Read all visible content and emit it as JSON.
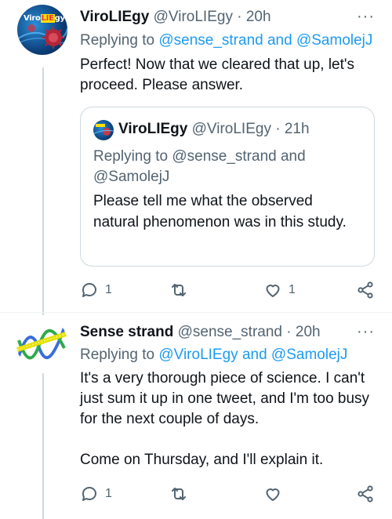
{
  "tweet1": {
    "name": "ViroLIEgy",
    "handle": "@ViroLIEgy",
    "separator": "·",
    "time": "20h",
    "more": "···",
    "replying_prefix": "Replying to ",
    "replying_mentions": "@sense_strand and @SamolejJ",
    "text": "Perfect! Now that we cleared that up, let's proceed. Please answer.",
    "avatar_logo": "ViroLIEgy",
    "quote": {
      "name": "ViroLIEgy",
      "handle": "@ViroLIEgy",
      "separator": "·",
      "time": "21h",
      "replying": "Replying to @sense_strand and @SamolejJ",
      "text": "Please tell me what the observed natural phenomenon was in this study."
    },
    "actions": {
      "reply_count": "1",
      "retweet_count": "",
      "like_count": "1"
    }
  },
  "tweet2": {
    "name": "Sense strand",
    "handle": "@sense_strand",
    "separator": "·",
    "time": "20h",
    "more": "···",
    "replying_prefix": "Replying to ",
    "replying_mentions": "@ViroLIEgy and @SamolejJ",
    "text_p1": "It's a very thorough piece of science. I can't just sum it up in one tweet, and I'm too busy for the next couple of days.",
    "text_p2": "Come on Thursday, and I'll explain it.",
    "actions": {
      "reply_count": "1",
      "retweet_count": "",
      "like_count": ""
    }
  },
  "colors": {
    "text": "#0f1419",
    "secondary": "#536471",
    "accent": "#1d9bf0",
    "border": "#cfd9de"
  },
  "icons": [
    "more-icon",
    "reply-icon",
    "retweet-icon",
    "like-icon",
    "share-icon"
  ]
}
